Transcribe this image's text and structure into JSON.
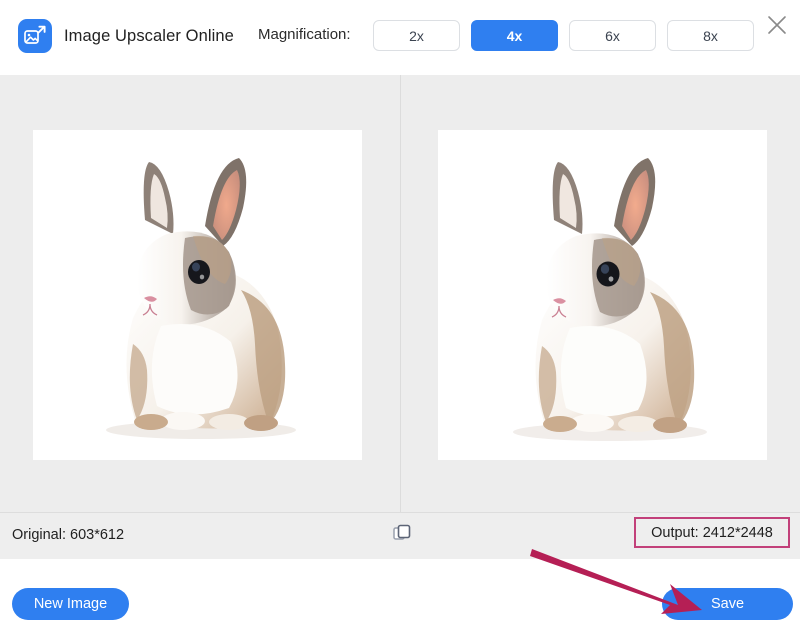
{
  "header": {
    "app_title": "Image Upscaler Online",
    "logo_icon": "image-upscale-icon",
    "magnification_label": "Magnification:",
    "magnification_options": [
      {
        "label": "2x",
        "selected": false
      },
      {
        "label": "4x",
        "selected": true
      },
      {
        "label": "6x",
        "selected": false
      },
      {
        "label": "8x",
        "selected": false
      }
    ],
    "close_icon": "close-icon"
  },
  "preview": {
    "original_image_alt": "rabbit",
    "upscaled_image_alt": "rabbit",
    "divider": true
  },
  "status": {
    "original_text": "Original: 603*612",
    "compare_icon": "copy-compare-icon",
    "output_text": "Output: 2412*2448",
    "output_highlight_color": "#c2407a"
  },
  "footer": {
    "new_image_label": "New Image",
    "save_label": "Save"
  },
  "annotation": {
    "arrow_icon": "pointer-arrow-icon",
    "arrow_color": "#b51f55"
  },
  "colors": {
    "accent_blue": "#2f7ff0",
    "panel_gray": "#ededed",
    "statusbar_gray": "#eeeeee",
    "highlight_pink": "#c2407a"
  }
}
